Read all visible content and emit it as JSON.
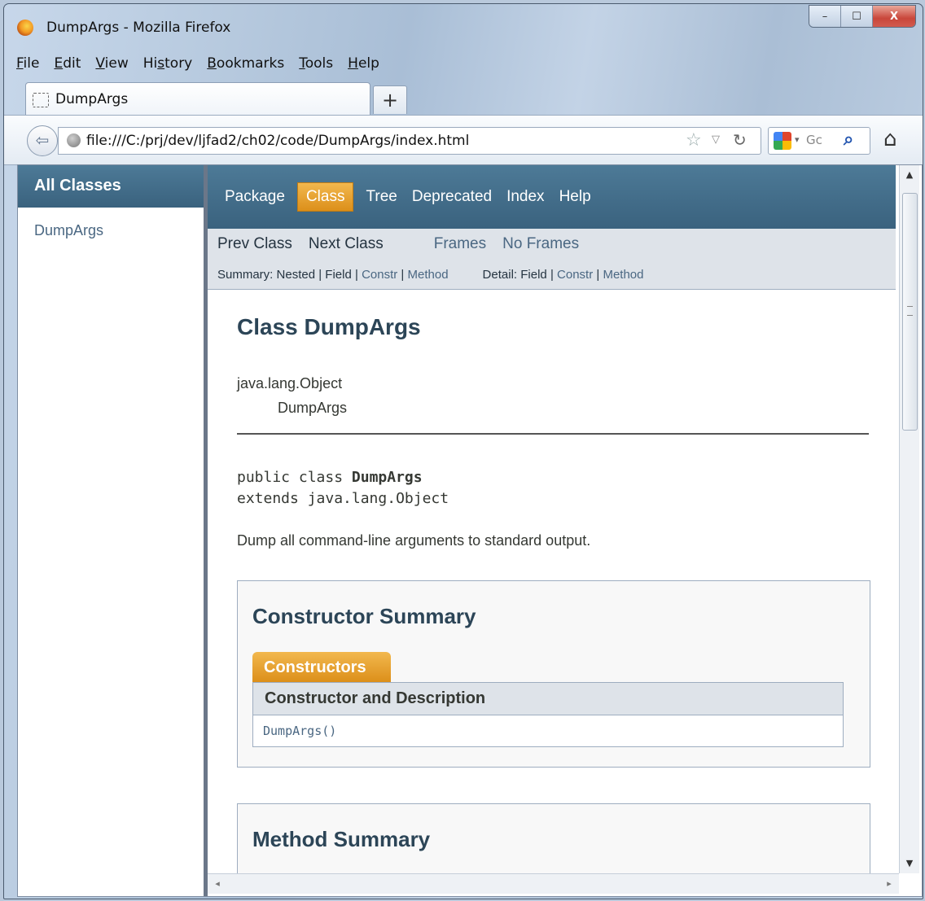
{
  "window": {
    "title": "DumpArgs - Mozilla Firefox",
    "buttons": {
      "minimize": "–",
      "maximize": "☐",
      "close": "X"
    }
  },
  "menu": [
    {
      "label": "File",
      "key": "F",
      "rest": "ile"
    },
    {
      "label": "Edit",
      "key": "E",
      "rest": "dit"
    },
    {
      "label": "View",
      "key": "V",
      "rest": "iew"
    },
    {
      "label": "History",
      "pre": "Hi",
      "key": "s",
      "rest": "tory"
    },
    {
      "label": "Bookmarks",
      "key": "B",
      "rest": "ookmarks"
    },
    {
      "label": "Tools",
      "key": "T",
      "rest": "ools"
    },
    {
      "label": "Help",
      "key": "H",
      "rest": "elp"
    }
  ],
  "tabs": {
    "active_label": "DumpArgs",
    "new_tab": "+"
  },
  "navbar": {
    "url": "file:///C:/prj/dev/ljfad2/ch02/code/DumpArgs/index.html",
    "search_text": "Gc",
    "icons": [
      "back-arrow-icon",
      "globe-icon",
      "star-icon",
      "dropdown-icon",
      "reload-icon",
      "google-icon",
      "search-icon",
      "home-icon"
    ]
  },
  "left_frame": {
    "header": "All Classes",
    "classes": [
      "DumpArgs"
    ]
  },
  "doc": {
    "topnav": [
      "Package",
      "Class",
      "Tree",
      "Deprecated",
      "Index",
      "Help"
    ],
    "topnav_active": "Class",
    "subnav": {
      "prev": "Prev Class",
      "next": "Next Class",
      "frames": "Frames",
      "no_frames": "No Frames"
    },
    "summary_line": {
      "label": "Summary:",
      "nested": "Nested",
      "sep": "|",
      "field": "Field",
      "constr": "Constr",
      "method": "Method"
    },
    "detail_line": {
      "label": "Detail:",
      "field": "Field",
      "constr": "Constr",
      "method": "Method"
    },
    "class_title": "Class DumpArgs",
    "inheritance": [
      "java.lang.Object",
      "DumpArgs"
    ],
    "signature": {
      "line1_prefix": "public class ",
      "line1_name": "DumpArgs",
      "line2": "extends java.lang.Object"
    },
    "description": "Dump all command-line arguments to standard output.",
    "constructor_summary": {
      "title": "Constructor Summary",
      "caption": "Constructors",
      "column": "Constructor and Description",
      "rows": [
        {
          "name": "DumpArgs",
          "params": "()"
        }
      ]
    },
    "method_summary": {
      "title": "Method Summary"
    }
  },
  "colors": {
    "nav_blue": "#4d7a97",
    "active_orange": "#dc8f1a",
    "link": "#4a6782",
    "subnav_bg": "#dee3e9"
  }
}
